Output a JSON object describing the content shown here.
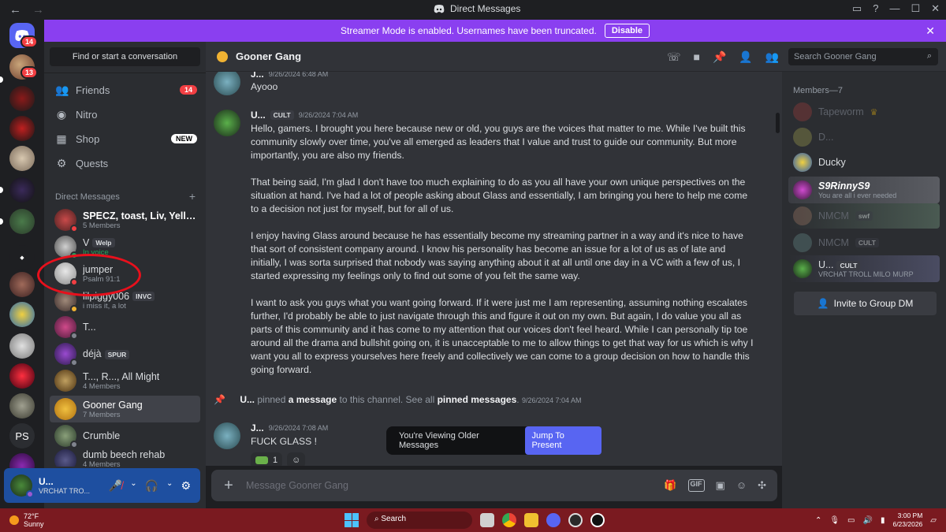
{
  "window": {
    "title": "Direct Messages",
    "back": "←",
    "forward": "→"
  },
  "banner": {
    "text": "Streamer Mode is enabled. Usernames have been truncated.",
    "button": "Disable"
  },
  "rail": {
    "home_badge": "14",
    "server_badge": "13",
    "ps_label": "PS"
  },
  "sidebar": {
    "search_placeholder": "Find or start a conversation",
    "nav": [
      {
        "label": "Friends",
        "pill": "14"
      },
      {
        "label": "Nitro",
        "pill": ""
      },
      {
        "label": "Shop",
        "pill": "NEW"
      },
      {
        "label": "Quests",
        "pill": ""
      }
    ],
    "dm_header": "Direct Messages",
    "dm_add": "+",
    "dms": [
      {
        "name": "SPECZ, toast, Liv, Yellow ...",
        "sub": "5 Members",
        "tag": ""
      },
      {
        "name": "V",
        "sub": "In voice",
        "tag": "Welp"
      },
      {
        "name": "jumper",
        "sub": "Psalm 91:1",
        "tag": ""
      },
      {
        "name": "lilpiggy006",
        "sub": "i miss it, a lot",
        "tag": "INVC"
      },
      {
        "name": "T...",
        "sub": "",
        "tag": ""
      },
      {
        "name": "déjà",
        "sub": "",
        "tag": "SPUR"
      },
      {
        "name": "T..., R..., All Might",
        "sub": "4 Members",
        "tag": ""
      },
      {
        "name": "Gooner Gang",
        "sub": "7 Members",
        "tag": ""
      },
      {
        "name": "Crumble",
        "sub": "",
        "tag": ""
      },
      {
        "name": "dumb beech rehab",
        "sub": "4 Members",
        "tag": ""
      }
    ]
  },
  "user": {
    "name": "U...",
    "status": "VRCHAT TRO..."
  },
  "chat": {
    "channel": "Gooner Gang",
    "search_placeholder": "Search Gooner Gang",
    "messages": [
      {
        "author": "J...",
        "time": "9/26/2024 6:48 AM",
        "tag": "",
        "body": [
          "Ayooo"
        ]
      },
      {
        "author": "U...",
        "time": "9/26/2024 7:04 AM",
        "tag": "CULT",
        "body": [
          "Hello, gamers. I brought you here because new or old, you guys are the voices that matter to me. While I've built this community slowly over time, you've all emerged as leaders that I value and trust to guide our community. But more importantly, you are also my friends.",
          "That being said, I'm glad I don't have too much explaining to do as you all have your own unique perspectives on the situation at hand. I've had a lot of people asking about Glass and essentially, I am bringing you here to help me come to a decision not just for myself, but for all of us.",
          "I enjoy having Glass around because he has essentially become my streaming partner in a way and it's nice to have that sort of consistent company around. I know his personality has become an issue for a lot of us as of late and initially, I was sorta surprised that nobody was saying anything about it at all until one day in a VC with a few of us, I started expressing my feelings only to find out some of you felt the same way.",
          "I want to ask you guys what you want going forward. If it were just me I am representing, assuming nothing escalates further, I'd probably be able to just navigate through this and figure it out on my own. But again, I do value you all as parts of this community and it has come to my attention that our voices don't feel heard. While I can personally tip toe around all the drama and bullshit going on, it is unacceptable to me to allow things to get that way for us which is why I want you all to express yourselves here freely and collectively we can come to a group decision on how to handle this going forward."
        ]
      },
      {
        "author": "J...",
        "time": "9/26/2024 7:08 AM",
        "tag": "",
        "body": [
          "FUCK GLASS !"
        ]
      }
    ],
    "pin": {
      "author": "U...",
      "pre": "pinned",
      "link1": "a message",
      "mid": "to this channel. See all",
      "link2": "pinned messages",
      "time": "9/26/2024 7:04 AM"
    },
    "reaction_count": "1",
    "older_text": "You're Viewing Older Messages",
    "jump_button": "Jump To Present",
    "composer_placeholder": "Message Gooner Gang"
  },
  "members": {
    "header": "Members—7",
    "list": [
      {
        "name": "Tapeworm",
        "sub": "",
        "dim": true
      },
      {
        "name": "D...",
        "sub": "",
        "dim": true
      },
      {
        "name": "Ducky",
        "sub": "",
        "dim": false
      },
      {
        "name": "S9RinnyS9",
        "sub": "You are all i ever needed",
        "dim": false
      },
      {
        "name": "NMCM",
        "sub": "",
        "dim": true,
        "tag": "swf"
      },
      {
        "name": "NMCM",
        "sub": "",
        "dim": true,
        "tag": "CULT"
      },
      {
        "name": "U...",
        "sub": "VRCHAT TROLL MILO MURP",
        "dim": false,
        "tag": "CULT"
      }
    ],
    "invite": "Invite to Group DM"
  },
  "taskbar": {
    "temp": "72°F",
    "weather": "Sunny",
    "search": "Search",
    "time": "3:00 PM",
    "date": "6/23/2026"
  },
  "colors": {
    "accent": "#5865f2",
    "banner": "#8a3ff0",
    "annotation": "#e8101c",
    "taskbar": "#7a1a20"
  }
}
